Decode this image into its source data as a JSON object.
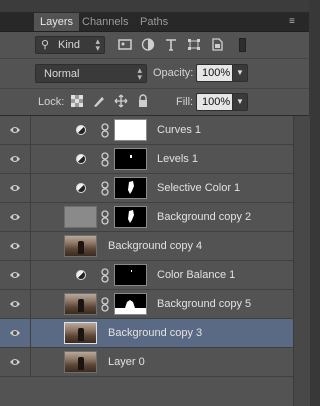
{
  "tabs": [
    "Layers",
    "Channels",
    "Paths"
  ],
  "filter": {
    "label": "Kind",
    "arrow": "⇕"
  },
  "blend_mode": "Normal",
  "opacity": {
    "label": "Opacity:",
    "value": "100%"
  },
  "lock_label": "Lock:",
  "fill": {
    "label": "Fill:",
    "value": "100%"
  },
  "layers": [
    {
      "name": "Curves 1",
      "visible": true,
      "type": "adjustment",
      "mask": "white"
    },
    {
      "name": "Levels 1",
      "visible": true,
      "type": "adjustment",
      "mask": "black"
    },
    {
      "name": "Selective Color 1",
      "visible": true,
      "type": "adjustment",
      "mask": "black"
    },
    {
      "name": "Background copy 2",
      "visible": true,
      "type": "pixel-masked",
      "mask": "black"
    },
    {
      "name": "Background copy 4",
      "visible": true,
      "type": "pixel"
    },
    {
      "name": "Color Balance 1",
      "visible": true,
      "type": "adjustment",
      "mask": "black"
    },
    {
      "name": "Background copy 5",
      "visible": true,
      "type": "pixel-masked",
      "mask": "silhouette"
    },
    {
      "name": "Background copy 3",
      "visible": true,
      "type": "pixel",
      "selected": true
    },
    {
      "name": "Layer 0",
      "visible": true,
      "type": "pixel"
    }
  ],
  "colors": {
    "panel": "#535353",
    "selected": "#5a6a84",
    "tabbar": "#282828"
  }
}
